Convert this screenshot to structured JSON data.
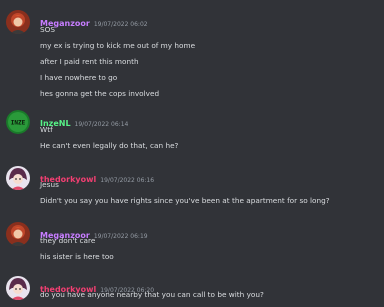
{
  "messages": [
    {
      "username": "Meganzoor",
      "user_color": "#c77dff",
      "timestamp": "19/07/2022 06:02",
      "avatar": "red-hair-avatar-icon",
      "lines": [
        "SOS",
        "my ex is trying to kick me out of my home",
        "after I paid rent this month",
        "I have nowhere to go",
        "hes gonna get the cops involved"
      ]
    },
    {
      "username": "InzeNL",
      "user_color": "#57f287",
      "timestamp": "19/07/2022 06:14",
      "avatar": "inze-logo-avatar-icon",
      "avatar_text": "INZE",
      "lines": [
        "Wtf",
        "He can't even legally do that, can he?"
      ]
    },
    {
      "username": "thedorkyowl",
      "user_color": "#f23f72",
      "timestamp": "19/07/2022 06:16",
      "avatar": "anime-character-avatar-icon",
      "lines": [
        "Jesus",
        "Didn't you say you have rights since you've been at the apartment for so long?"
      ]
    },
    {
      "username": "Meganzoor",
      "user_color": "#c77dff",
      "timestamp": "19/07/2022 06:19",
      "avatar": "red-hair-avatar-icon",
      "lines": [
        "they don't care",
        "his sister is here too"
      ]
    },
    {
      "username": "thedorkyowl",
      "user_color": "#f23f72",
      "timestamp": "19/07/2022 06:20",
      "avatar": "anime-character-avatar-icon",
      "lines": [
        "do you have anyone nearby that you can call to be with you?"
      ]
    }
  ]
}
